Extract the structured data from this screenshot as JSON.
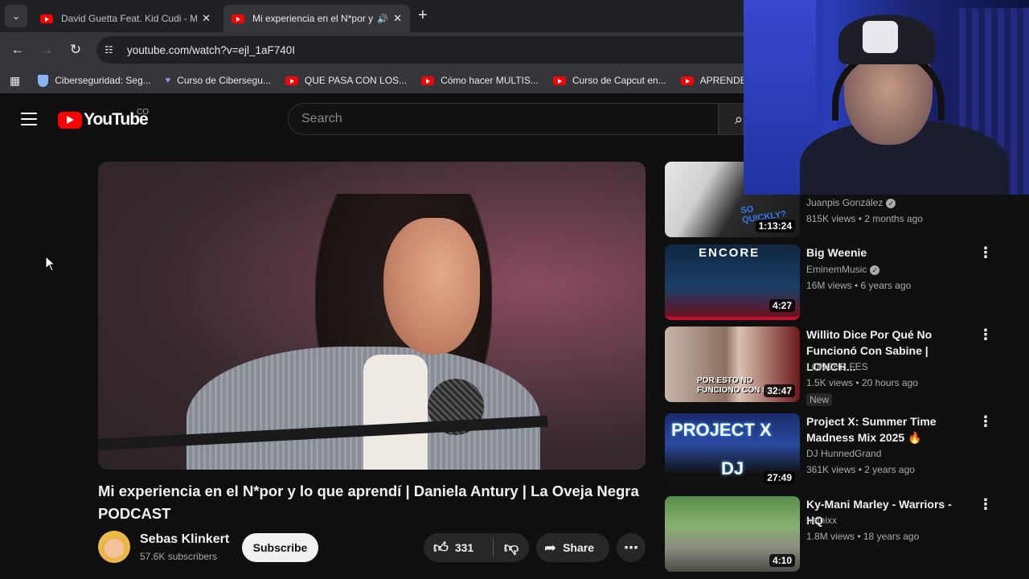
{
  "browser": {
    "tabs": [
      {
        "title": "David Guetta Feat. Kid Cudi - M",
        "active": false
      },
      {
        "title": "Mi experiencia en el N*por y",
        "active": true
      }
    ],
    "url": "youtube.com/watch?v=ejl_1aF740I",
    "bookmarks": [
      {
        "label": "Ciberseguridad: Seg...",
        "icon": "shield-icon"
      },
      {
        "label": "Curso de Cibersegu...",
        "icon": "gem-icon"
      },
      {
        "label": "QUE PASA CON LOS...",
        "icon": "youtube-icon"
      },
      {
        "label": "Cómo hacer MULTIS...",
        "icon": "youtube-icon"
      },
      {
        "label": "Curso de Capcut en...",
        "icon": "youtube-icon"
      },
      {
        "label": "APRENDE a ED",
        "icon": "youtube-icon"
      }
    ]
  },
  "youtube": {
    "logo_text": "YouTube",
    "region": "CO",
    "search_placeholder": "Search"
  },
  "video": {
    "title": "Mi experiencia en el N*por y lo que aprendí | Daniela Antury | La Oveja Negra PODCAST",
    "channel": "Sebas Klinkert",
    "subscribers": "57.6K subscribers",
    "subscribe_label": "Subscribe",
    "likes": "331",
    "share_label": "Share"
  },
  "sidebar": [
    {
      "title": "",
      "channel": "Juanpis González",
      "verified": true,
      "meta": "815K views • 2 months ago",
      "duration": "1:13:24"
    },
    {
      "title": "Big Weenie",
      "channel": "EminemMusic",
      "verified": true,
      "meta": "16M views • 6 years ago",
      "duration": "4:27"
    },
    {
      "title": "Willito Dice Por Qué No Funcionó Con Sabine | LONCH...",
      "channel": "LONCHE FES",
      "verified": false,
      "meta": "1.5K views • 20 hours ago",
      "badge": "New",
      "duration": "32:47"
    },
    {
      "title": "Project X: Summer Time Madness Mix 2025 🔥",
      "channel": "DJ HunnedGrand",
      "verified": false,
      "meta": "361K views • 2 years ago",
      "duration": "27:49"
    },
    {
      "title": "Ky-Mani Marley - Warriors - HQ",
      "channel": "netnixx",
      "verified": false,
      "meta": "1.8M views • 18 years ago",
      "duration": "4:10"
    }
  ],
  "thumb_text": {
    "t0": "SO QUICKLY?",
    "t1": "ENCORE",
    "t2": "POR ESTO NO FUNCIONO CON SAL...",
    "t3a": "PROJECT X",
    "t3b": "DJ"
  }
}
